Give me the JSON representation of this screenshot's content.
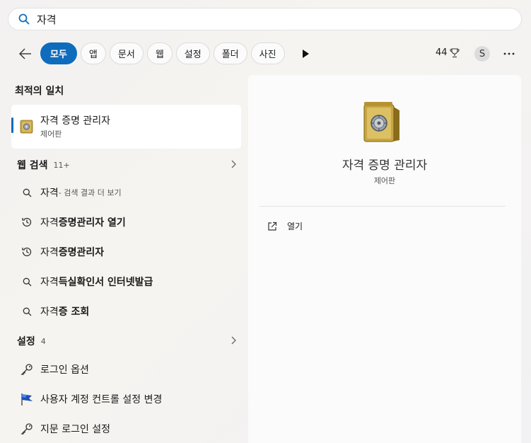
{
  "search": {
    "query": "자격"
  },
  "filters": {
    "chips": [
      {
        "label": "모두",
        "active": true
      },
      {
        "label": "앱"
      },
      {
        "label": "문서"
      },
      {
        "label": "웹"
      },
      {
        "label": "설정"
      },
      {
        "label": "폴더"
      },
      {
        "label": "사진"
      }
    ],
    "points": "44"
  },
  "user": {
    "initial": "S"
  },
  "best_match": {
    "title": "최적의 일치",
    "name": "자격 증명 관리자",
    "sub": "제어판"
  },
  "web": {
    "label": "웹 검색",
    "count": "11+",
    "items": [
      {
        "prefix": "자격",
        "bold": "",
        "suffix": " - 검색 결과 더 보기"
      },
      {
        "prefix": "자격",
        "bold": "증명관리자 열기"
      },
      {
        "prefix": "자격",
        "bold": "증명관리자"
      },
      {
        "prefix": "자격",
        "bold": "득실확인서 인터넷발급"
      },
      {
        "prefix": "자격",
        "bold": "증 조회"
      }
    ]
  },
  "settings": {
    "label": "설정",
    "count": "4",
    "items": [
      {
        "label": "로그인 옵션"
      },
      {
        "label": "사용자 계정 컨트롤 설정 변경"
      },
      {
        "label": "지문 로그인 설정"
      }
    ]
  },
  "preview": {
    "title": "자격 증명 관리자",
    "sub": "제어판",
    "action": "열기"
  },
  "colors": {
    "accent": "#0f6cbd"
  }
}
